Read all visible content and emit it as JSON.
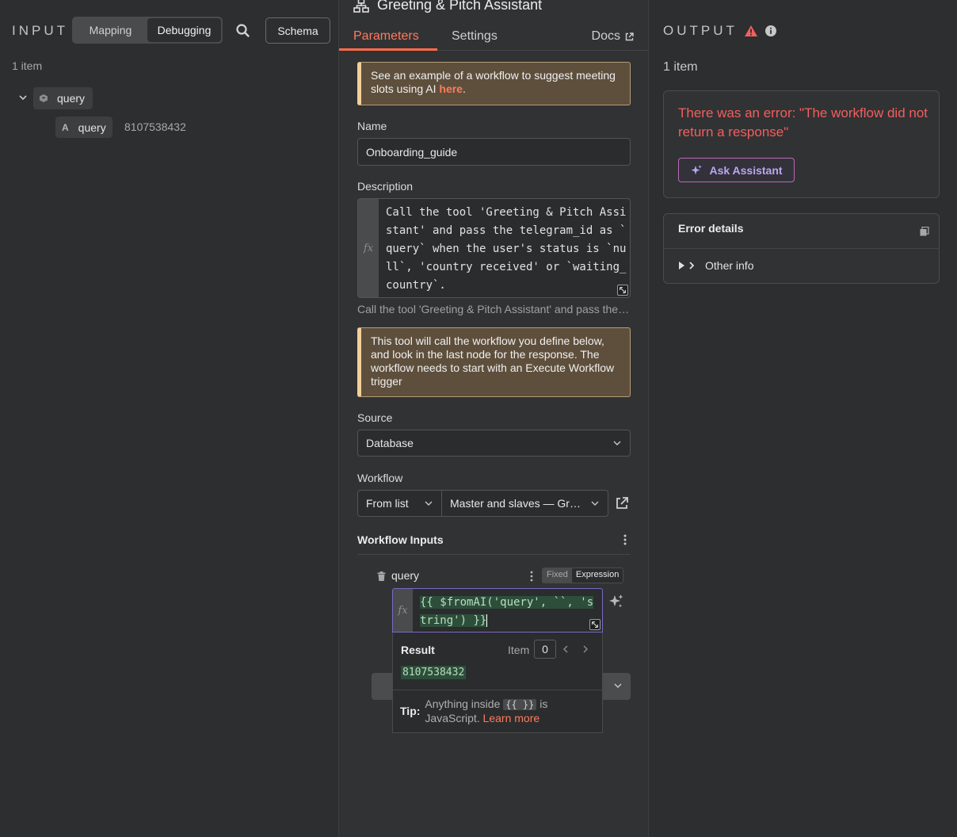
{
  "input": {
    "title": "INPUT",
    "toggle": {
      "mapping": "Mapping",
      "debugging": "Debugging"
    },
    "schema_label": "Schema",
    "count": "1 item",
    "tree": {
      "root": "query",
      "leaf_type": "A",
      "leaf_name": "query",
      "leaf_value": "8107538432"
    }
  },
  "node": {
    "title": "Greeting & Pitch Assistant",
    "tabs": {
      "parameters": "Parameters",
      "settings": "Settings",
      "docs": "Docs"
    }
  },
  "params": {
    "notice1_text": "See an example of a workflow to suggest meeting slots using AI ",
    "notice1_link": "here",
    "notice1_end": ".",
    "name_label": "Name",
    "name_value": "Onboarding_guide",
    "description_label": "Description",
    "description_value": "Call the tool 'Greeting & Pitch Assistant' and pass the telegram_id as `query` when the user's status is `null`, 'country received' or `waiting_country`.",
    "description_preview": "Call the tool 'Greeting & Pitch Assistant' and pass the telegram_id as `query`",
    "notice2_text": "This tool will call the workflow you define below, and look in the last node for the response. The workflow needs to start with an Execute Workflow trigger",
    "source_label": "Source",
    "source_value": "Database",
    "workflow_label": "Workflow",
    "workflow_mode": "From list",
    "workflow_value": "Master and slaves — Greeting & Pitch Assistant",
    "workflow_inputs_label": "Workflow Inputs",
    "query_label": "query",
    "fixed_label": "Fixed",
    "expression_label": "Expression",
    "fx_symbol": "fx",
    "expression_value": "{{ $fromAI('query', ``, 'string') }}",
    "result_label": "Result",
    "item_label": "Item",
    "item_index": "0",
    "result_value": "8107538432",
    "tip_label": "Tip:",
    "tip_text_1": "Anything inside ",
    "tip_code": "{{ }}",
    "tip_text_2": " is JavaScript. ",
    "tip_link": "Learn more"
  },
  "output": {
    "title": "OUTPUT",
    "count": "1 item",
    "error_message": "There was an error: \"The workflow did not return a response\"",
    "ask_assistant": "Ask Assistant",
    "error_details_title": "Error details",
    "other_info": "Other info"
  },
  "colors": {
    "accent": "#ff6d4c",
    "error": "#f35e5e",
    "assistant": "#b9a8ef",
    "notice_bg": "#5e4f3c",
    "expression_bg": "#2d4e3a"
  },
  "icons": [
    "search-icon",
    "cube-icon",
    "chevron-down-icon",
    "workflow-icon",
    "external-link-icon",
    "kebab-menu-icon",
    "trash-icon",
    "sparkle-icon",
    "warning-icon",
    "info-icon",
    "copy-icon",
    "caret-right-icon"
  ]
}
